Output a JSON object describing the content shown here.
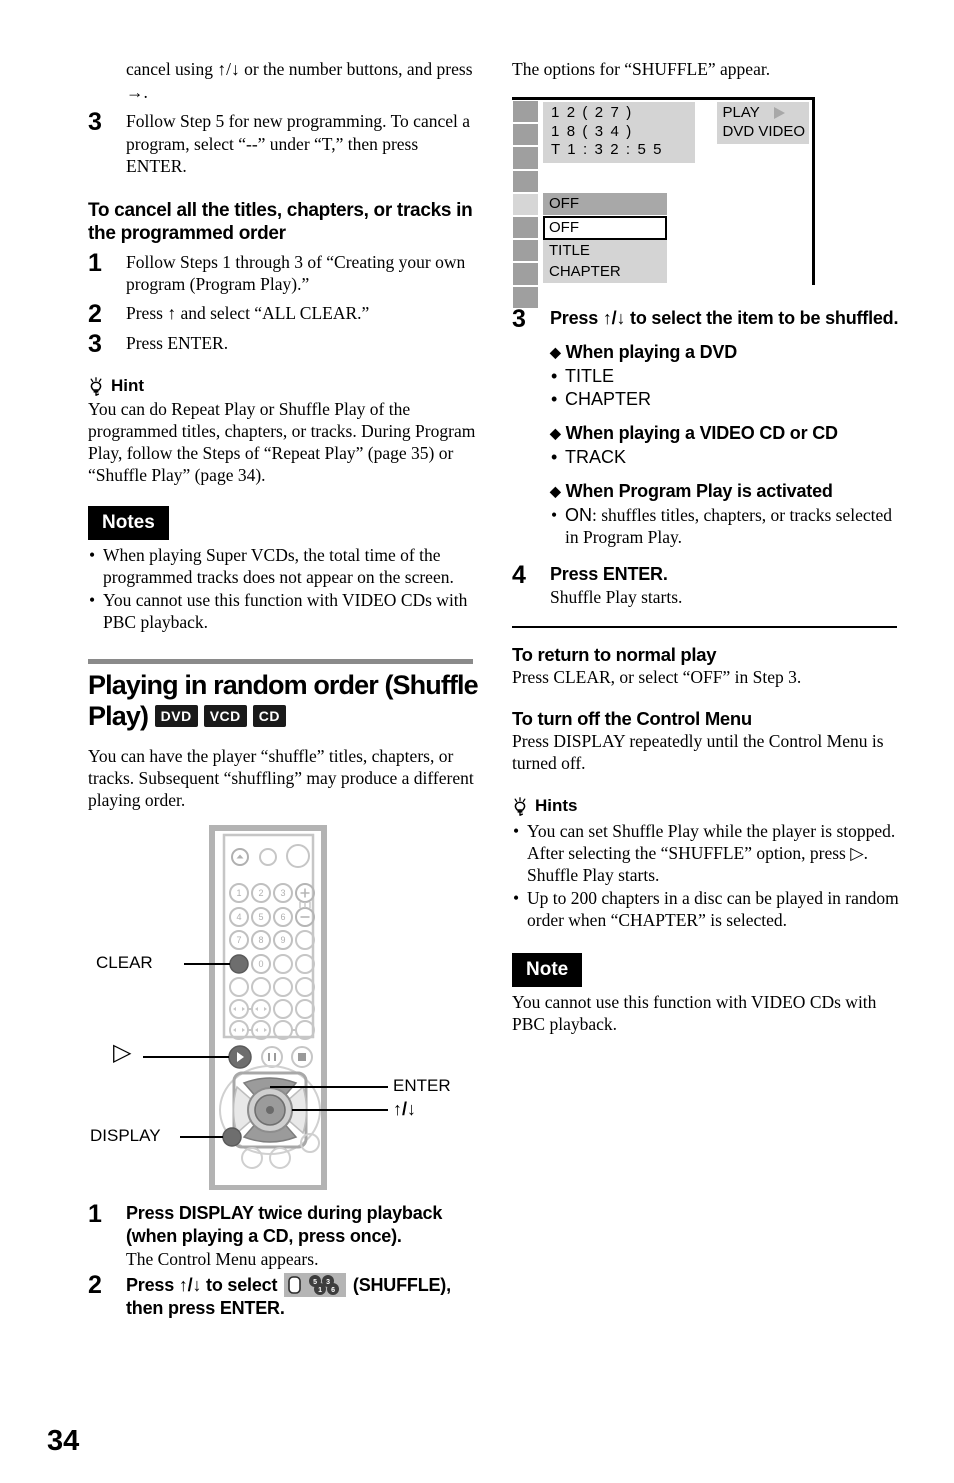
{
  "page": {
    "number": "34"
  },
  "left_column": {
    "cont_step_text": "cancel using ↑/↓ or the number buttons, and press →.",
    "step3": {
      "num": "3",
      "text": "Follow Step 5 for new programming. To cancel a program, select “--” under “T,” then press ENTER."
    },
    "cancel_heading": "To cancel all the titles, chapters, or tracks in the programmed order",
    "cancel_steps": [
      {
        "num": "1",
        "text": "Follow Steps 1 through 3 of “Creating your own program (Program Play).”"
      },
      {
        "num": "2",
        "text": "Press ↑ and select “ALL CLEAR.”"
      },
      {
        "num": "3",
        "text": "Press ENTER."
      }
    ],
    "hint": {
      "icon": "lightbulb-icon",
      "label": "Hint",
      "text": "You can do Repeat Play or Shuffle Play of the programmed titles, chapters, or tracks. During Program Play, follow the Steps of “Repeat Play” (page 35) or “Shuffle Play” (page 34)."
    },
    "notes": {
      "label": "Notes",
      "items": [
        "When playing Super VCDs, the total time of the programmed tracks does not appear on the screen.",
        "You cannot use this function with VIDEO CDs with PBC playback."
      ]
    },
    "section": {
      "title": "Playing in random order (Shuffle Play)",
      "badges": [
        "DVD",
        "VCD",
        "CD"
      ],
      "intro": "You can have the player “shuffle” titles, chapters, or tracks. Subsequent “shuffling” may produce a different playing order."
    },
    "remote": {
      "callouts": [
        {
          "name": "clear-callout",
          "label": "CLEAR"
        },
        {
          "name": "play-callout",
          "label": "▷"
        },
        {
          "name": "display-callout",
          "label": "DISPLAY"
        },
        {
          "name": "enter-callout",
          "label": "ENTER"
        },
        {
          "name": "updown-callout",
          "label": "↑/↓"
        }
      ],
      "keys": [
        "1",
        "2",
        "3",
        "4",
        "5",
        "6",
        "7",
        "8",
        "9",
        "0"
      ]
    },
    "steps": [
      {
        "num": "1",
        "title": "Press DISPLAY twice during playback (when playing a CD, press once).",
        "sub": "The Control Menu appears."
      },
      {
        "num": "2",
        "title_a": "Press ↑/↓ to select",
        "title_b": "(SHUFFLE), then press ENTER.",
        "icon": "shuffle-icon",
        "icon_digits": [
          "5",
          "3",
          "1",
          "6"
        ]
      }
    ]
  },
  "right_column": {
    "options_caption": "The options for “SHUFFLE” appear.",
    "osd": {
      "time_lines": [
        "1 2 ( 2 7 )",
        "1 8 ( 3 4 )",
        "T   1 : 3 2 : 5 5"
      ],
      "status": {
        "play": "PLAY",
        "disc": "DVD VIDEO",
        "play_icon": "play-triangle-icon"
      },
      "current_value": "OFF",
      "options": [
        "OFF",
        "TITLE",
        "CHAPTER"
      ],
      "selected_option": "OFF"
    },
    "step3": {
      "num": "3",
      "title": "Press ↑/↓ to select the item to be shuffled.",
      "groups": [
        {
          "heading": "When playing a DVD",
          "items": [
            "TITLE",
            "CHAPTER"
          ]
        },
        {
          "heading": "When playing a VIDEO CD or CD",
          "items": [
            "TRACK"
          ]
        },
        {
          "heading": "When Program Play is activated",
          "items_rich": [
            {
              "lead": "ON",
              "rest": ": shuffles titles, chapters, or tracks selected in Program Play."
            }
          ]
        }
      ]
    },
    "step4": {
      "num": "4",
      "title": "Press ENTER.",
      "sub": "Shuffle Play starts."
    },
    "return_heading": "To return to normal play",
    "return_text": "Press CLEAR, or select “OFF” in Step 3.",
    "turnoff_heading": "To turn off the Control Menu",
    "turnoff_text": "Press DISPLAY repeatedly until the Control Menu is turned off.",
    "hints": {
      "icon": "lightbulb-icon",
      "label": "Hints",
      "items": [
        "You can set Shuffle Play while the player is stopped. After selecting the “SHUFFLE” option, press ▷. Shuffle Play starts.",
        "Up to 200 chapters in a disc can be played in random order when “CHAPTER” is selected."
      ]
    },
    "note": {
      "label": "Note",
      "text": "You cannot use this function with VIDEO CDs with PBC playback."
    }
  },
  "colors": {
    "rule_gray": "#8a8a8a",
    "osd_panel": "#d4d4d4",
    "osd_rail": "#9f9f9f",
    "osd_highlight": "#a8a8a8",
    "badge_bg": "#1a1a1a"
  }
}
